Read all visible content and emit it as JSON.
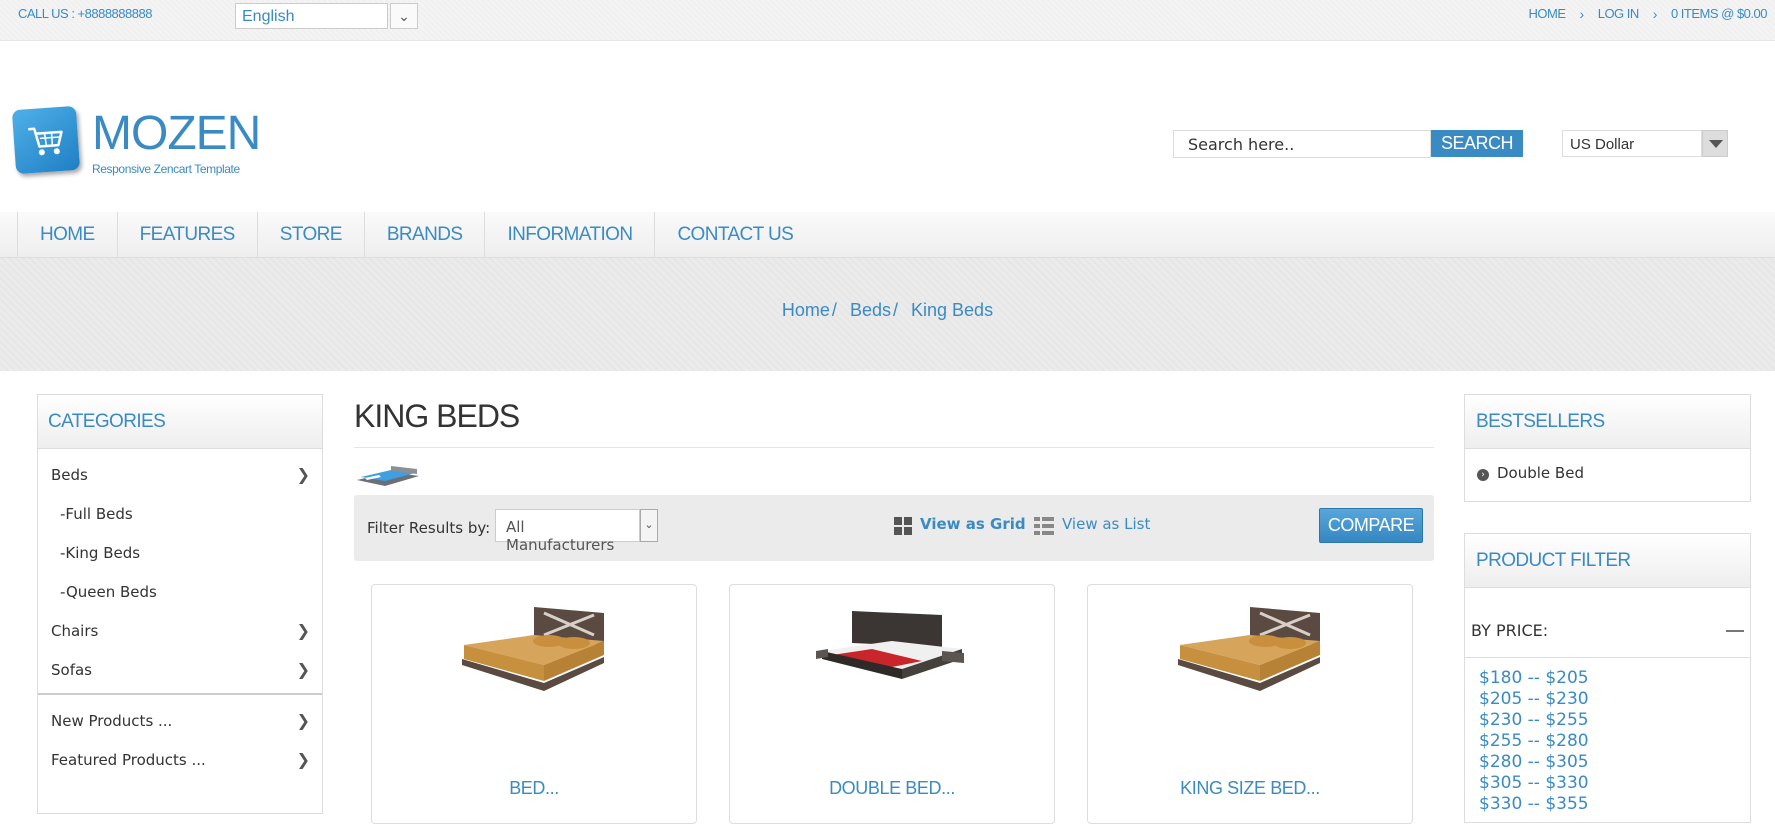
{
  "topbar": {
    "call_us": "CALL US : +8888888888",
    "language": "English",
    "links": [
      "HOME",
      "LOG IN",
      "0 ITEMS @ $0.00"
    ]
  },
  "header": {
    "brand": "MOZEN",
    "tagline": "Responsive Zencart Template",
    "search_placeholder": "Search here..",
    "search_button": "SEARCH",
    "currency": "US Dollar"
  },
  "nav": {
    "items": [
      "HOME",
      "FEATURES",
      "STORE",
      "BRANDS",
      "INFORMATION",
      "CONTACT US"
    ]
  },
  "breadcrumb": [
    "Home",
    "Beds",
    "King Beds"
  ],
  "sidebar": {
    "title": "CATEGORIES",
    "categories": [
      {
        "label": "Beds",
        "arrow": true
      },
      {
        "label": "-Full Beds",
        "arrow": false
      },
      {
        "label": "-King Beds",
        "arrow": false
      },
      {
        "label": "-Queen Beds",
        "arrow": false
      },
      {
        "label": "Chairs",
        "arrow": true
      },
      {
        "label": "Sofas",
        "arrow": true
      }
    ],
    "extras": [
      "New Products ...",
      "Featured Products ..."
    ]
  },
  "main": {
    "title": "KING BEDS",
    "filter_label": "Filter Results by:",
    "manufacturer": "All Manufacturers",
    "view_grid": "View as Grid",
    "view_list": "View as List",
    "compare": "COMPARE",
    "products": [
      "BED...",
      "DOUBLE BED...",
      "KING SIZE BED..."
    ]
  },
  "right": {
    "bestsellers_title": "BESTSELLERS",
    "bestsellers": [
      "Double Bed"
    ],
    "filter_title": "PRODUCT FILTER",
    "by_price": "BY PRICE:",
    "price_ranges": [
      "$180 -- $205",
      "$205 -- $230",
      "$230 -- $255",
      "$255 -- $280",
      "$280 -- $305",
      "$305 -- $330",
      "$330 -- $355"
    ]
  },
  "colors": {
    "accent": "#3a8bc3",
    "text": "#333333",
    "band": "#ebebeb"
  }
}
